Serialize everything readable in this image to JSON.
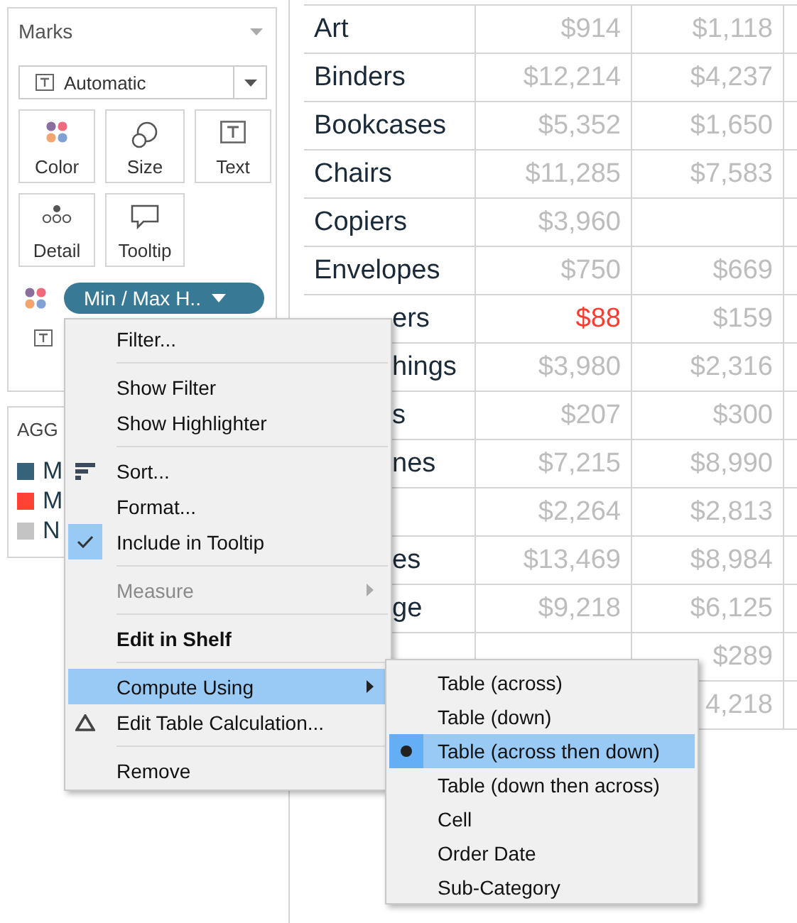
{
  "marks": {
    "title": "Marks",
    "mark_type": "Automatic",
    "cards": [
      {
        "kind": "color",
        "label": "Color"
      },
      {
        "kind": "size",
        "label": "Size"
      },
      {
        "kind": "text",
        "label": "Text"
      },
      {
        "kind": "detail",
        "label": "Detail"
      },
      {
        "kind": "tooltip",
        "label": "Tooltip"
      }
    ],
    "fields": [
      {
        "kind": "color",
        "label": "Min / Max H.."
      },
      {
        "kind": "text"
      }
    ]
  },
  "legend": {
    "title": "AGG",
    "items": [
      {
        "label": "M",
        "color": "#37637a"
      },
      {
        "label": "M",
        "color": "#ff4136"
      },
      {
        "label": "N",
        "color": "#c4c4c4"
      }
    ]
  },
  "table": {
    "rows": [
      {
        "kind": "full",
        "label": "Art",
        "cells": [
          {
            "text": "$914",
            "color": "#bdbdbd"
          },
          {
            "text": "$1,118",
            "color": "#bdbdbd"
          }
        ]
      },
      {
        "kind": "full",
        "label": "Binders",
        "cells": [
          {
            "text": "$12,214",
            "color": "#bdbdbd"
          },
          {
            "text": "$4,237",
            "color": "#bdbdbd"
          }
        ]
      },
      {
        "kind": "full",
        "label": "Bookcases",
        "cells": [
          {
            "text": "$5,352",
            "color": "#bdbdbd"
          },
          {
            "text": "$1,650",
            "color": "#bdbdbd"
          }
        ]
      },
      {
        "kind": "full",
        "label": "Chairs",
        "cells": [
          {
            "text": "$11,285",
            "color": "#bdbdbd"
          },
          {
            "text": "$7,583",
            "color": "#bdbdbd"
          }
        ]
      },
      {
        "kind": "full",
        "label": "Copiers",
        "cells": [
          {
            "text": "$3,960",
            "color": "#bdbdbd"
          },
          null
        ]
      },
      {
        "kind": "full",
        "label": "Envelopes",
        "cells": [
          {
            "text": "$750",
            "color": "#bdbdbd"
          },
          {
            "text": "$669",
            "color": "#bdbdbd"
          }
        ]
      },
      {
        "kind": "tail",
        "label": "ers",
        "cells": [
          {
            "text": "$88",
            "color": "#ff3b30"
          },
          {
            "text": "$159",
            "color": "#bdbdbd"
          }
        ]
      },
      {
        "kind": "tail",
        "label": "hings",
        "cells": [
          {
            "text": "$3,980",
            "color": "#bdbdbd"
          },
          {
            "text": "$2,316",
            "color": "#bdbdbd"
          }
        ]
      },
      {
        "kind": "tail",
        "label": "s",
        "cells": [
          {
            "text": "$207",
            "color": "#bdbdbd"
          },
          {
            "text": "$300",
            "color": "#bdbdbd"
          }
        ]
      },
      {
        "kind": "tail",
        "label": "nes",
        "cells": [
          {
            "text": "$7,215",
            "color": "#bdbdbd"
          },
          {
            "text": "$8,990",
            "color": "#bdbdbd"
          }
        ]
      },
      {
        "cells": [
          {
            "text": "$2,264",
            "color": "#bdbdbd"
          },
          {
            "text": "$2,813",
            "color": "#bdbdbd"
          }
        ]
      },
      {
        "kind": "tail",
        "label": "es",
        "cells": [
          {
            "text": "$13,469",
            "color": "#bdbdbd"
          },
          {
            "text": "$8,984",
            "color": "#bdbdbd"
          }
        ]
      },
      {
        "kind": "tail",
        "label": "ge",
        "cells": [
          {
            "text": "$9,218",
            "color": "#bdbdbd"
          },
          {
            "text": "$6,125",
            "color": "#bdbdbd"
          }
        ]
      },
      {
        "cells": [
          null,
          {
            "text": "$289",
            "color": "#bdbdbd"
          }
        ]
      },
      {
        "cells": [
          null,
          {
            "text": "4,218",
            "color": "#bdbdbd"
          }
        ]
      }
    ]
  },
  "context_menu": {
    "items": [
      {
        "kind": "action",
        "label": "Filter...",
        "checked": false,
        "disabled": false,
        "selected": false
      },
      {
        "kind": "separator"
      },
      {
        "kind": "action",
        "label": "Show Filter",
        "checked": false,
        "disabled": false,
        "selected": false
      },
      {
        "kind": "action",
        "label": "Show Highlighter",
        "checked": false,
        "disabled": false,
        "selected": false
      },
      {
        "kind": "separator"
      },
      {
        "kind": "sort",
        "label": "Sort...",
        "checked": false,
        "disabled": false,
        "selected": false
      },
      {
        "kind": "action",
        "label": "Format...",
        "checked": false,
        "disabled": false,
        "selected": false
      },
      {
        "kind": "action",
        "label": "Include in Tooltip",
        "checked": true,
        "disabled": false,
        "selected": false
      },
      {
        "kind": "separator"
      },
      {
        "kind": "submenu",
        "label": "Measure",
        "checked": false,
        "disabled": true,
        "selected": false
      },
      {
        "kind": "separator"
      },
      {
        "kind": "default",
        "label": "Edit in Shelf",
        "checked": false,
        "disabled": false,
        "selected": false
      },
      {
        "kind": "separator"
      },
      {
        "kind": "submenu",
        "label": "Compute Using",
        "checked": false,
        "disabled": false,
        "selected": true
      },
      {
        "kind": "table-calc",
        "label": "Edit Table Calculation...",
        "checked": false,
        "disabled": false,
        "selected": false
      },
      {
        "kind": "separator"
      },
      {
        "kind": "action",
        "label": "Remove",
        "checked": false,
        "disabled": false,
        "selected": false
      }
    ]
  },
  "submenu": {
    "items": [
      {
        "label": "Table (across)",
        "selected": false
      },
      {
        "label": "Table (down)",
        "selected": false
      },
      {
        "label": "Table (across then down)",
        "selected": true
      },
      {
        "label": "Table (down then across)",
        "selected": false
      },
      {
        "label": "Cell",
        "selected": false
      },
      {
        "label": "Order Date",
        "selected": false
      },
      {
        "label": "Sub-Category",
        "selected": false
      }
    ]
  }
}
